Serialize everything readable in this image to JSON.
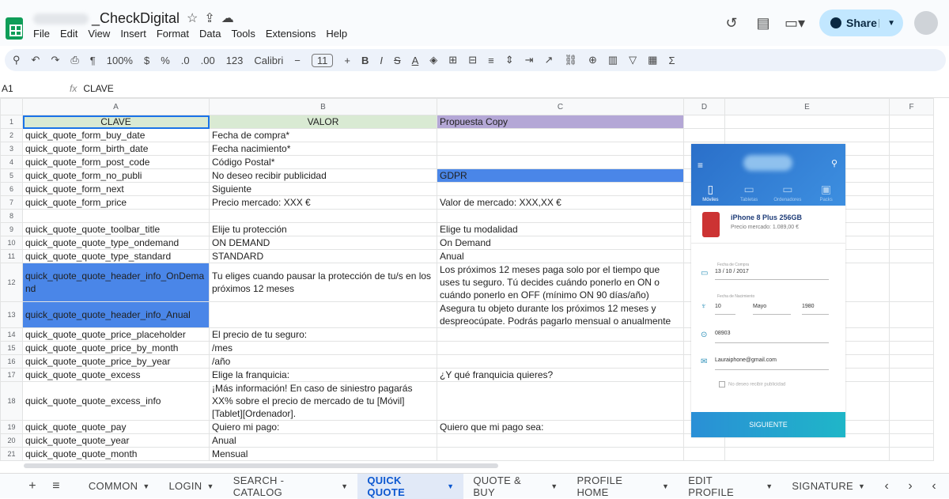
{
  "doc": {
    "title": "_CheckDigital"
  },
  "menu": [
    "File",
    "Edit",
    "View",
    "Insert",
    "Format",
    "Data",
    "Tools",
    "Extensions",
    "Help"
  ],
  "share_label": "Share",
  "toolbar": {
    "zoom": "100%",
    "currency": "$",
    "percent": "%",
    "dec_less": ".0",
    "dec_more": ".00",
    "numfmt": "123",
    "font": "Calibri",
    "font_size": "11"
  },
  "formula": {
    "cell": "A1",
    "value": "CLAVE"
  },
  "columns": [
    "A",
    "B",
    "C",
    "D",
    "E",
    "F"
  ],
  "rows": [
    {
      "n": "1",
      "a": "CLAVE",
      "b": "VALOR",
      "c": "Propuesta Copy"
    },
    {
      "n": "2",
      "a": "quick_quote_form_buy_date",
      "b": "Fecha de compra*",
      "c": ""
    },
    {
      "n": "3",
      "a": "quick_quote_form_birth_date",
      "b": "Fecha nacimiento*",
      "c": ""
    },
    {
      "n": "4",
      "a": "quick_quote_form_post_code",
      "b": "Código Postal*",
      "c": ""
    },
    {
      "n": "5",
      "a": "quick_quote_form_no_publi",
      "b": "No deseo recibir publicidad",
      "c": "GDPR"
    },
    {
      "n": "6",
      "a": "quick_quote_form_next",
      "b": "Siguiente",
      "c": ""
    },
    {
      "n": "7",
      "a": "quick_quote_form_price",
      "b": "Precio mercado: XXX €",
      "c": "Valor de mercado: XXX,XX €"
    },
    {
      "n": "8",
      "a": "",
      "b": "",
      "c": ""
    },
    {
      "n": "9",
      "a": "quick_quote_quote_toolbar_title",
      "b": "Elije tu protección",
      "c": "Elige tu modalidad"
    },
    {
      "n": "10",
      "a": "quick_quote_quote_type_ondemand",
      "b": "ON DEMAND",
      "c": "On Demand"
    },
    {
      "n": "11",
      "a": "quick_quote_quote_type_standard",
      "b": "STANDARD",
      "c": "Anual"
    },
    {
      "n": "12",
      "a": "quick_quote_quote_header_info_OnDemand",
      "b": "Tu eliges cuando pausar la protección de tu/s en los próximos 12 meses",
      "c": "Los próximos 12 meses paga solo por el tiempo que uses tu seguro. Tú decides cuándo ponerlo en ON o cuándo ponerlo en OFF (mínimo ON 90 días/año)"
    },
    {
      "n": "13",
      "a": "quick_quote_quote_header_info_Anual",
      "b": "",
      "c": "Asegura tu objeto durante los próximos 12 meses y despreocúpate. Podrás pagarlo mensual o anualmente"
    },
    {
      "n": "14",
      "a": "quick_quote_quote_price_placeholder",
      "b": "El precio de tu seguro:",
      "c": ""
    },
    {
      "n": "15",
      "a": "quick_quote_quote_price_by_month",
      "b": "/mes",
      "c": ""
    },
    {
      "n": "16",
      "a": "quick_quote_quote_price_by_year",
      "b": "/año",
      "c": ""
    },
    {
      "n": "17",
      "a": "quick_quote_quote_excess",
      "b": "Elige la franquicia:",
      "c": "¿Y qué franquicia quieres?"
    },
    {
      "n": "18",
      "a": "quick_quote_quote_excess_info",
      "b": "¡Más información! En caso de siniestro pagarás XX% sobre el precio de mercado de tu [Móvil][Tablet][Ordenador].",
      "c": ""
    },
    {
      "n": "19",
      "a": "quick_quote_quote_pay",
      "b": "Quiero mi pago:",
      "c": "Quiero que mi pago sea:"
    },
    {
      "n": "20",
      "a": "quick_quote_quote_year",
      "b": "Anual",
      "c": ""
    },
    {
      "n": "21",
      "a": "quick_quote_quote_month",
      "b": "Mensual",
      "c": ""
    }
  ],
  "mockup": {
    "tabs": [
      "Móviles",
      "Tabletas",
      "Ordenadores",
      "Packs"
    ],
    "product_name": "iPhone 8 Plus 256GB",
    "product_price": "Precio mercado: 1.089,00 €",
    "buy_label": "Fecha de Compra",
    "buy_value": "13 / 10 / 2017",
    "birth_label": "Fecha de Nacimiento",
    "birth_day": "10",
    "birth_month": "Mayo",
    "birth_year": "1980",
    "postcode": "08903",
    "email": "Lauraiphone@gmail.com",
    "no_publi": "No deseo recibir publicidad",
    "button": "SIGUIENTE"
  },
  "sheets": [
    "COMMON",
    "LOGIN",
    "SEARCH - CATALOG",
    "QUICK QUOTE",
    "QUOTE & BUY",
    "PROFILE HOME",
    "EDIT PROFILE",
    "SIGNATURE"
  ],
  "active_sheet": "QUICK QUOTE"
}
